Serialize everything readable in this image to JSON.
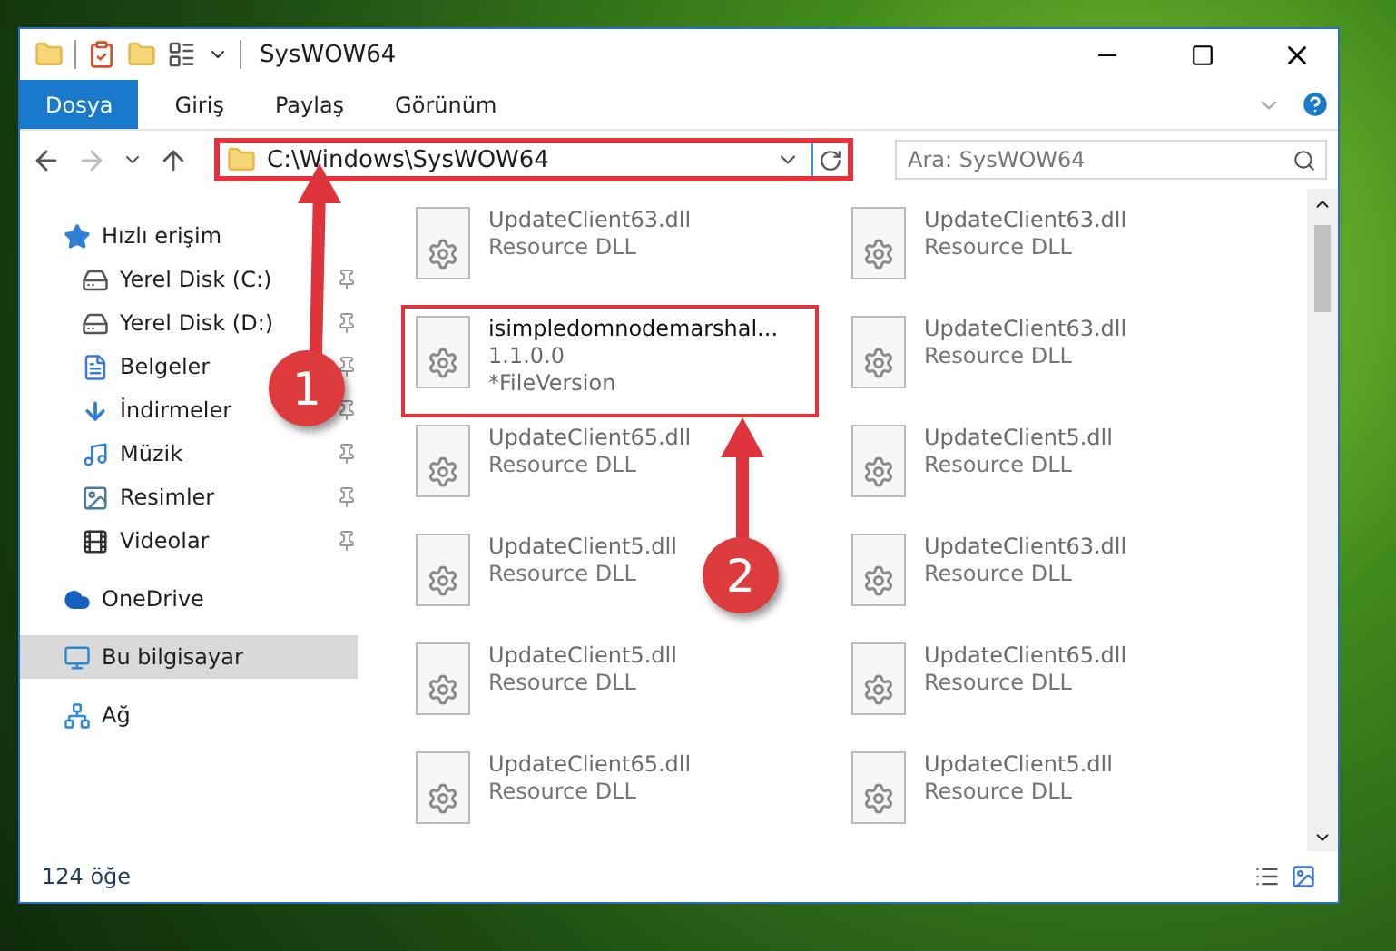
{
  "window": {
    "title": "SysWOW64"
  },
  "ribbon_tabs": [
    {
      "label": "Dosya",
      "selected": true
    },
    {
      "label": "Giriş",
      "selected": false
    },
    {
      "label": "Paylaş",
      "selected": false
    },
    {
      "label": "Görünüm",
      "selected": false
    }
  ],
  "address": {
    "path": "C:\\Windows\\SysWOW64",
    "highlighted": true
  },
  "search": {
    "placeholder": "Ara: SysWOW64"
  },
  "sidebar": {
    "items": [
      {
        "label": "Hızlı erişim",
        "kind": "quick",
        "selected": false,
        "children": [
          {
            "label": "Yerel Disk (C:)",
            "kind": "drive",
            "pinned": true,
            "selected": false
          },
          {
            "label": "Yerel Disk (D:)",
            "kind": "drive",
            "pinned": true,
            "selected": false
          },
          {
            "label": "Belgeler",
            "kind": "documents",
            "pinned": true,
            "selected": false
          },
          {
            "label": "İndirmeler",
            "kind": "downloads",
            "pinned": true,
            "selected": false
          },
          {
            "label": "Müzik",
            "kind": "music",
            "pinned": true,
            "selected": false
          },
          {
            "label": "Resimler",
            "kind": "pictures",
            "pinned": true,
            "selected": false
          },
          {
            "label": "Videolar",
            "kind": "videos",
            "pinned": true,
            "selected": false
          }
        ]
      },
      {
        "label": "OneDrive",
        "kind": "cloud",
        "selected": false
      },
      {
        "label": "Bu bilgisayar",
        "kind": "computer",
        "selected": true
      },
      {
        "label": "Ağ",
        "kind": "network",
        "selected": false
      }
    ]
  },
  "files": [
    {
      "name": "UpdateClient63.dll",
      "lines": [
        "Resource DLL"
      ],
      "blurred": true,
      "highlighted": false
    },
    {
      "name": "UpdateClient63.dll",
      "lines": [
        "Resource DLL"
      ],
      "blurred": true,
      "highlighted": false
    },
    {
      "name": "isimpledomnodemarshal...",
      "lines": [
        "1.1.0.0",
        "*FileVersion"
      ],
      "blurred": false,
      "highlighted": true
    },
    {
      "name": "UpdateClient63.dll",
      "lines": [
        "Resource DLL"
      ],
      "blurred": true,
      "highlighted": false
    },
    {
      "name": "UpdateClient65.dll",
      "lines": [
        "Resource DLL"
      ],
      "blurred": true,
      "highlighted": false
    },
    {
      "name": "UpdateClient5.dll",
      "lines": [
        "Resource DLL"
      ],
      "blurred": true,
      "highlighted": false
    },
    {
      "name": "UpdateClient5.dll",
      "lines": [
        "Resource DLL"
      ],
      "blurred": true,
      "highlighted": false
    },
    {
      "name": "UpdateClient63.dll",
      "lines": [
        "Resource DLL"
      ],
      "blurred": true,
      "highlighted": false
    },
    {
      "name": "UpdateClient5.dll",
      "lines": [
        "Resource DLL"
      ],
      "blurred": true,
      "highlighted": false
    },
    {
      "name": "UpdateClient65.dll",
      "lines": [
        "Resource DLL"
      ],
      "blurred": true,
      "highlighted": false
    },
    {
      "name": "UpdateClient65.dll",
      "lines": [
        "Resource DLL"
      ],
      "blurred": true,
      "highlighted": false
    },
    {
      "name": "UpdateClient5.dll",
      "lines": [
        "Resource DLL"
      ],
      "blurred": true,
      "highlighted": false
    }
  ],
  "status_bar": {
    "item_count": "124 öğe"
  },
  "annotations": [
    {
      "number": "1"
    },
    {
      "number": "2"
    }
  ]
}
